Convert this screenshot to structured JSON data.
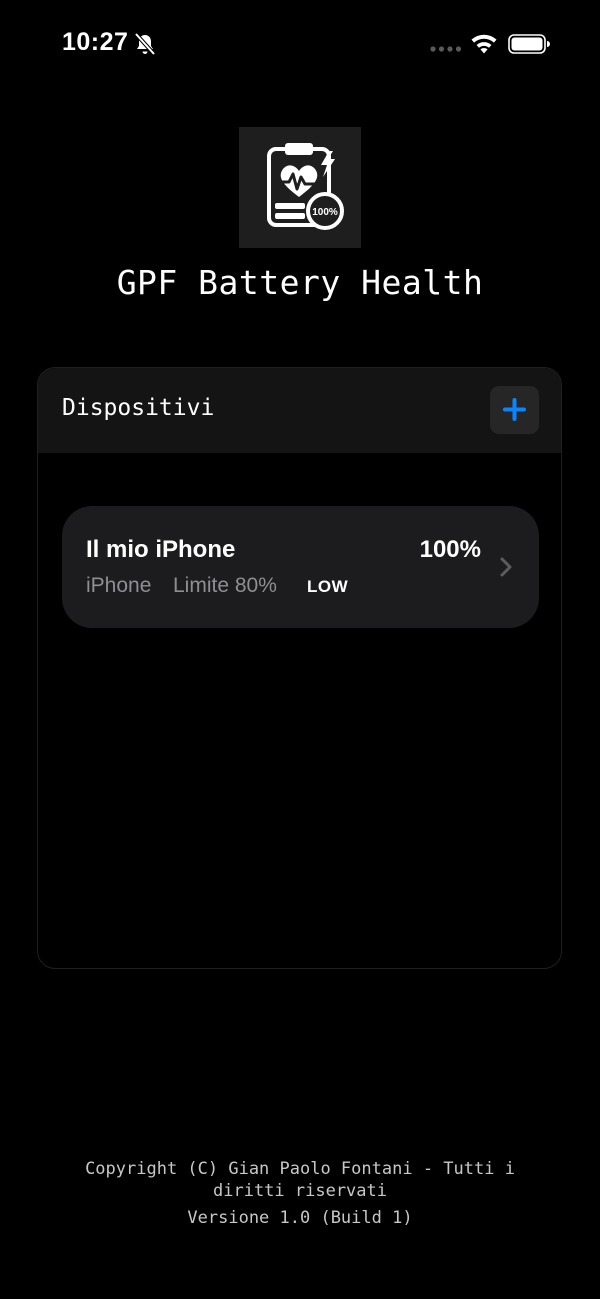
{
  "status_bar": {
    "time": "10:27",
    "icons": [
      "bell-slash-icon",
      "signal-icon",
      "wifi-icon",
      "battery-icon"
    ]
  },
  "app": {
    "title": "GPF Battery Health",
    "logo_badge": "100%"
  },
  "devices_panel": {
    "title": "Dispositivi",
    "add_icon": "plus-icon",
    "accent_color": "#0a84ff",
    "items": [
      {
        "name": "Il mio iPhone",
        "percent": "100%",
        "type": "iPhone",
        "limit": "Limite 80%",
        "mode": "LOW"
      }
    ]
  },
  "footer": {
    "copyright": "Copyright (C) Gian Paolo Fontani - Tutti i diritti riservati",
    "version": "Versione 1.0 (Build 1)"
  }
}
